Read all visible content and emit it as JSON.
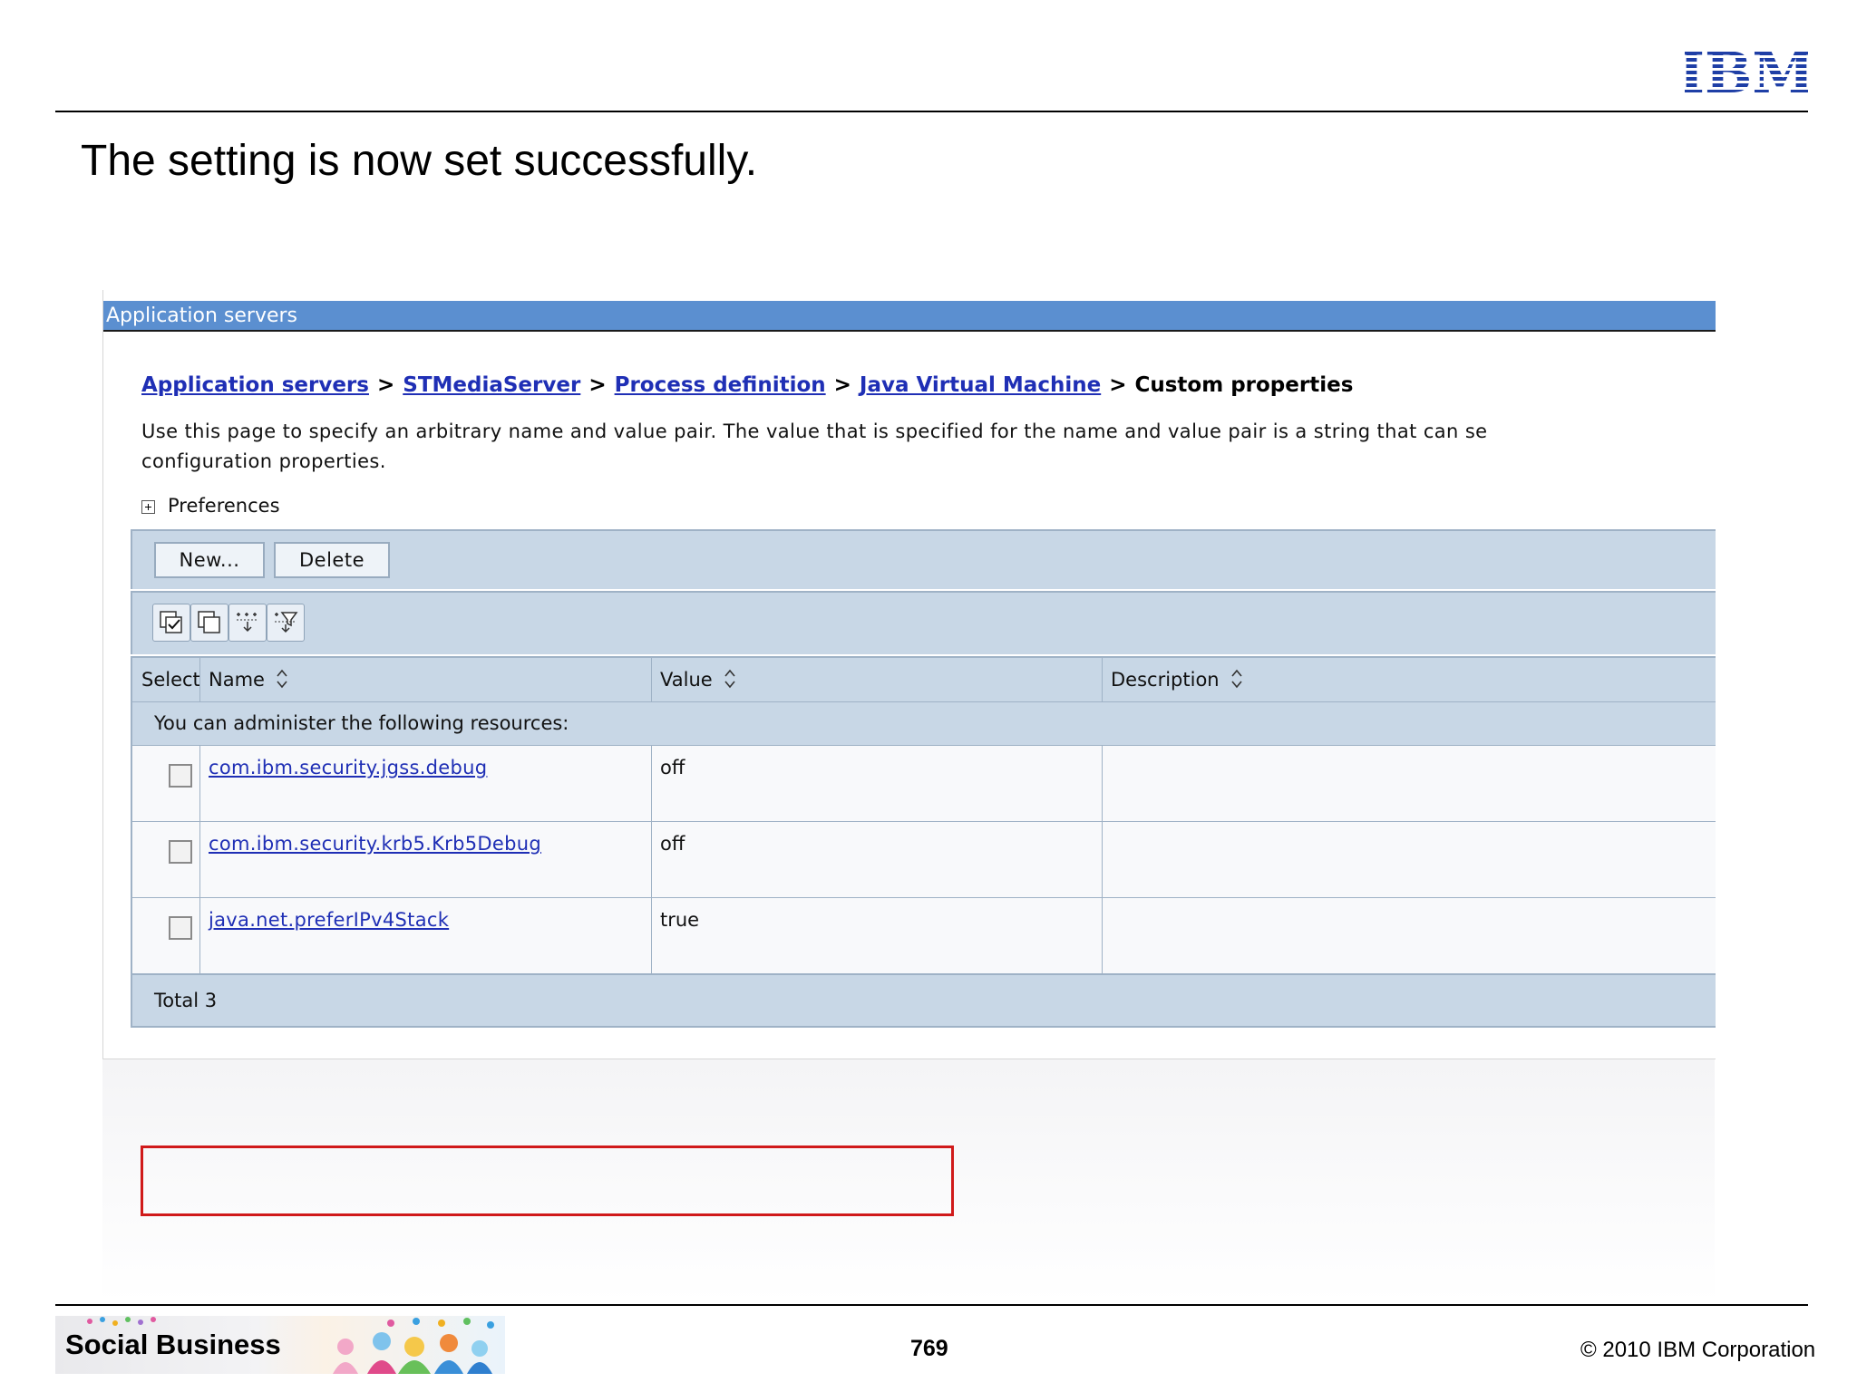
{
  "slide": {
    "title": "The setting is now set successfully.",
    "logo": "IBM",
    "footer_brand": "Social Business",
    "page_number": "769",
    "copyright": "© 2010 IBM Corporation"
  },
  "console": {
    "title": "Application servers",
    "breadcrumb": {
      "items": [
        "Application servers",
        "STMediaServer",
        "Process definition",
        "Java Virtual Machine"
      ],
      "separator": ">",
      "current": "Custom properties"
    },
    "intro_lines": [
      "Use this page to specify an arbitrary name and value pair. The value that is specified for the name and value pair is a string that can se",
      "configuration properties."
    ],
    "preferences_label": "Preferences",
    "buttons": {
      "new": "New...",
      "delete": "Delete"
    },
    "tool_icons": [
      "select-all-icon",
      "deselect-all-icon",
      "show-filter-icon",
      "clear-filter-icon"
    ],
    "table": {
      "columns": [
        "Select",
        "Name",
        "Value",
        "Description"
      ],
      "resources_caption": "You can administer the following resources:",
      "rows": [
        {
          "name": "com.ibm.security.jgss.debug",
          "value": "off",
          "description": ""
        },
        {
          "name": "com.ibm.security.krb5.Krb5Debug",
          "value": "off",
          "description": ""
        },
        {
          "name": "java.net.preferIPv4Stack",
          "value": "true",
          "description": ""
        }
      ],
      "total": "Total 3"
    },
    "highlight_color": "#d01a1a",
    "titlebar_color": "#5b8fd0",
    "link_color": "#1f2fb5"
  }
}
